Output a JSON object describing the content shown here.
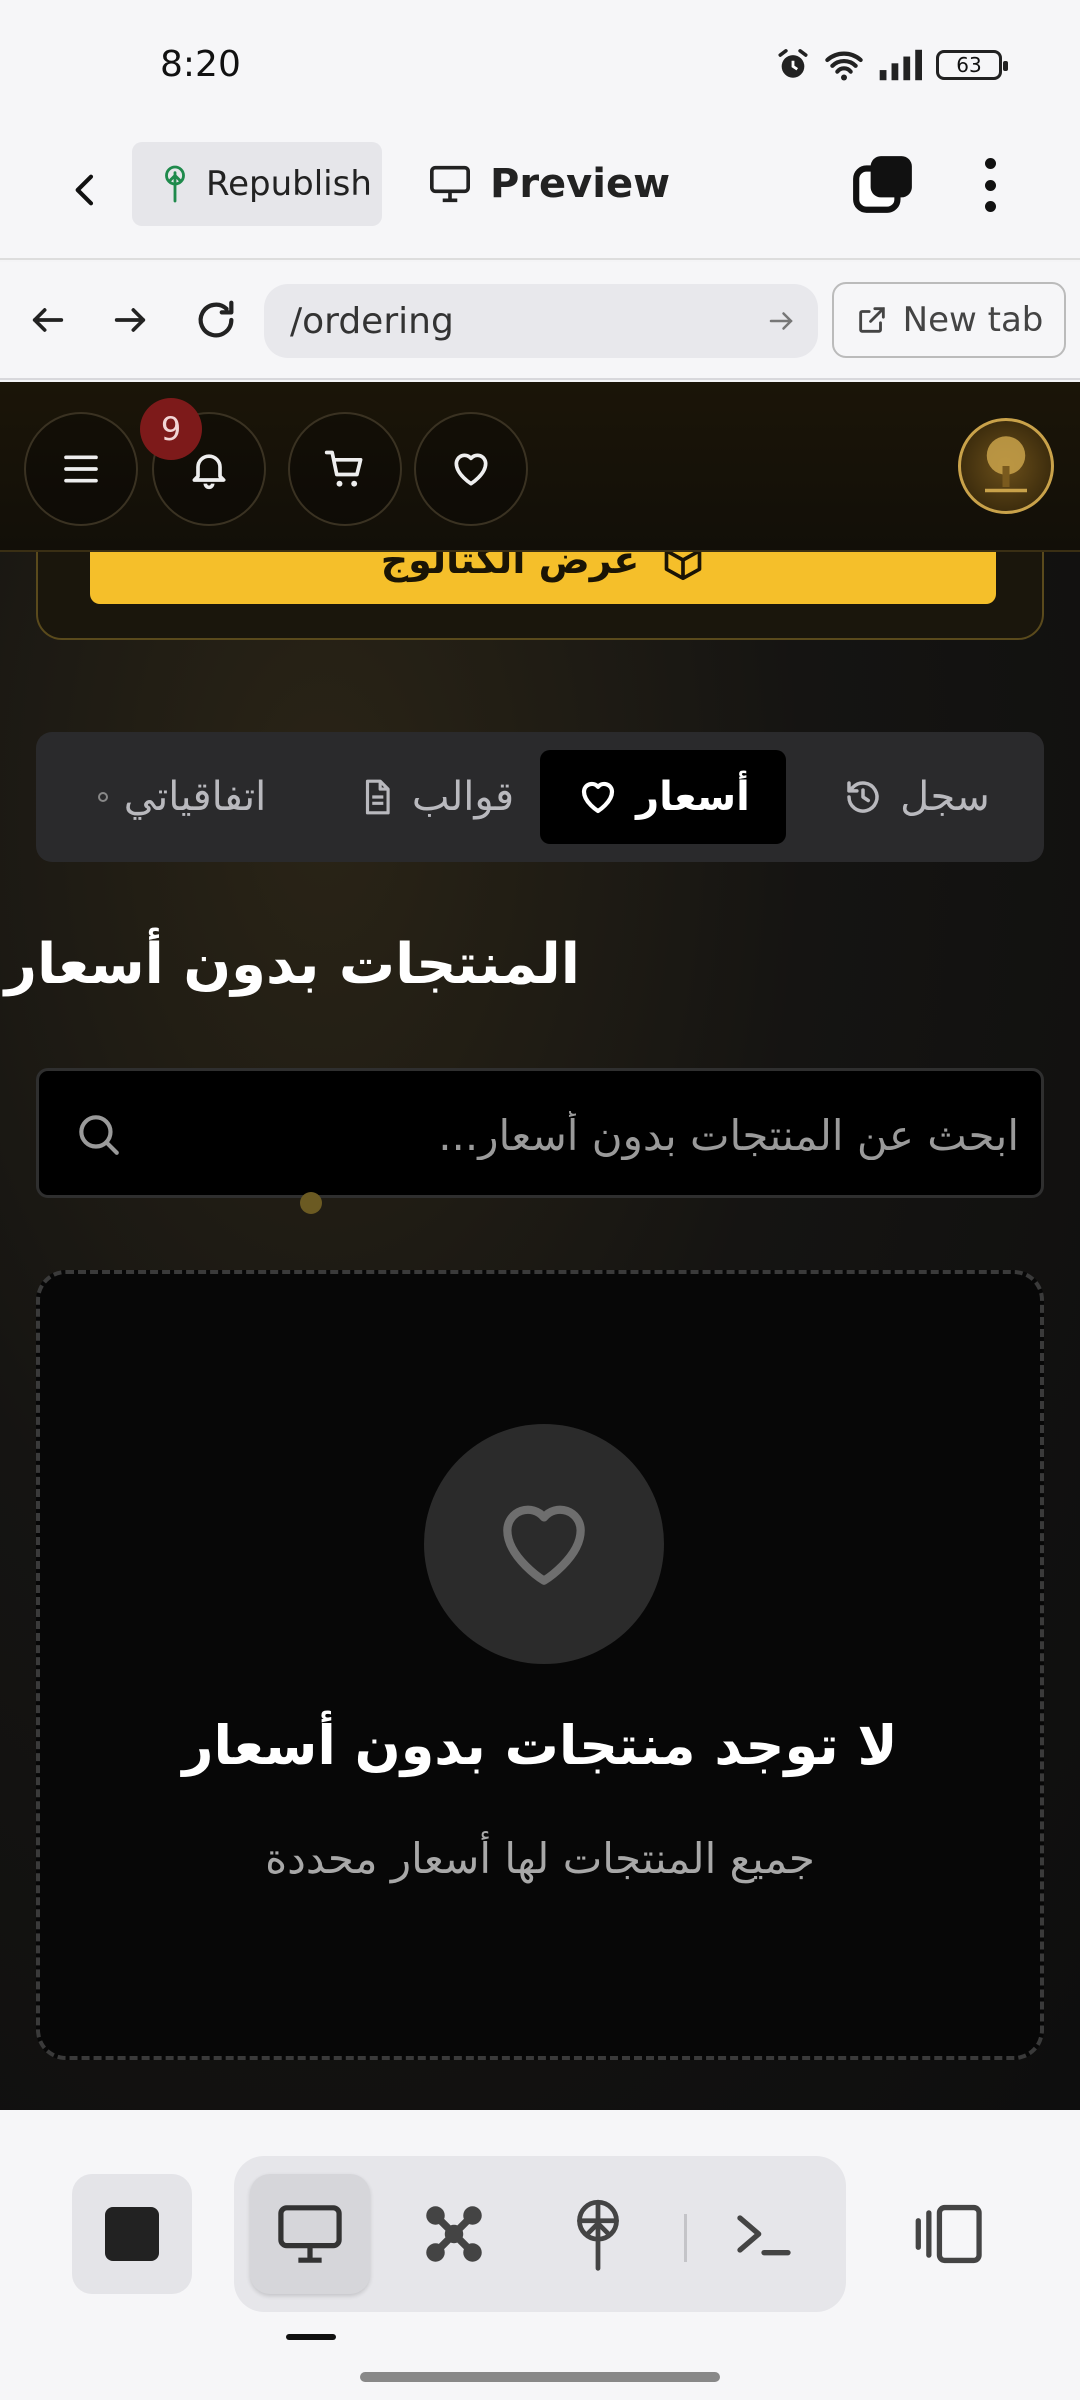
{
  "status_bar": {
    "time": "8:20",
    "battery": "63"
  },
  "toolbar": {
    "republish_label": "Republish",
    "preview_label": "Preview"
  },
  "browser": {
    "url": "/ordering",
    "new_tab_label": "New tab"
  },
  "site": {
    "notification_count": "9",
    "catalog_button_label": "عرض الكتالوج",
    "tabs": [
      {
        "label": "اتفاقياتي",
        "icon": "dot-icon"
      },
      {
        "label": "قوالب",
        "icon": "document-icon"
      },
      {
        "label": "أسعار",
        "icon": "heart-icon",
        "active": true
      },
      {
        "label": "سجل",
        "icon": "history-icon"
      }
    ],
    "section_title": "المنتجات بدون أسعار",
    "search_placeholder": "ابحث عن المنتجات بدون أسعار...",
    "empty_title": "لا توجد منتجات بدون أسعار",
    "empty_subtitle": "جميع المنتجات لها أسعار محددة"
  },
  "colors": {
    "accent": "#f5bf2a",
    "badge": "#7d1a1a",
    "background": "#0e0e0e"
  }
}
